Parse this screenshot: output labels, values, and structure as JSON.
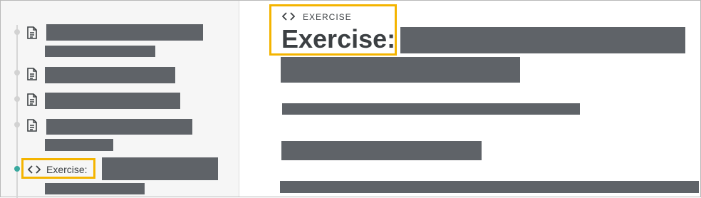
{
  "sidebar": {
    "items": [
      {
        "type": "document",
        "icon": "document-icon"
      },
      {
        "type": "document",
        "icon": "document-icon"
      },
      {
        "type": "document",
        "icon": "document-icon"
      },
      {
        "type": "document",
        "icon": "document-icon"
      },
      {
        "type": "exercise",
        "icon": "code-icon",
        "label": "Exercise:",
        "active": true
      }
    ]
  },
  "main": {
    "eyebrow": "EXERCISE",
    "title_prefix": "Exercise:",
    "icon": "code-icon"
  },
  "colors": {
    "highlight": "#f4b400",
    "redaction": "#5f6368",
    "active_dot": "#3aa99f",
    "text": "#3c4043"
  }
}
